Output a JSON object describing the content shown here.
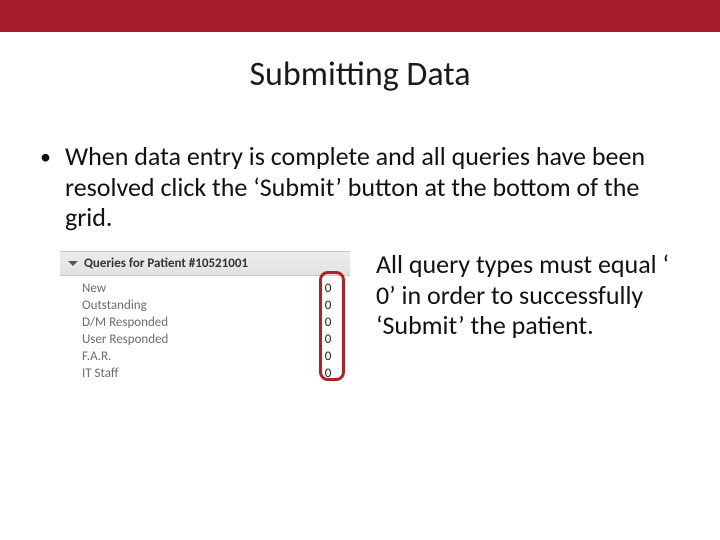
{
  "title": "Submitting Data",
  "bullet": "When data entry is complete and all queries have been resolved click the ‘Submit’ button at the bottom of the grid.",
  "panel_header": "Queries for Patient #10521001",
  "queries": [
    {
      "label": "New",
      "value": "0"
    },
    {
      "label": "Outstanding",
      "value": "0"
    },
    {
      "label": "D/M Responded",
      "value": "0"
    },
    {
      "label": "User Responded",
      "value": "0"
    },
    {
      "label": "F.A.R.",
      "value": "0"
    },
    {
      "label": "IT Staff",
      "value": "0"
    }
  ],
  "side_text": "All query types must equal ‘ 0’ in order to successfully ‘Submit’ the patient."
}
